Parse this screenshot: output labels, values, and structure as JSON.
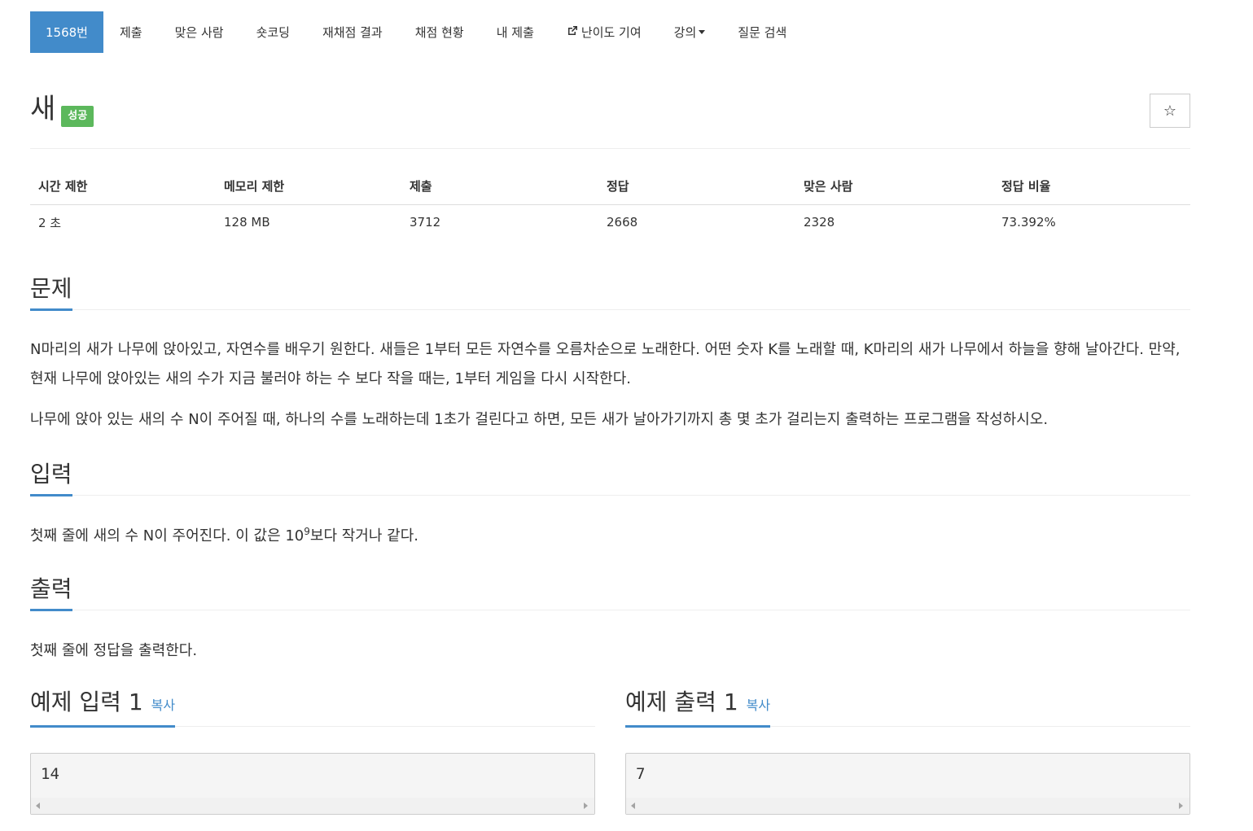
{
  "nav": {
    "items": [
      {
        "label": "1568번",
        "active": true
      },
      {
        "label": "제출"
      },
      {
        "label": "맞은 사람"
      },
      {
        "label": "숏코딩"
      },
      {
        "label": "재채점 결과"
      },
      {
        "label": "채점 현황"
      },
      {
        "label": "내 제출"
      },
      {
        "label": "난이도 기여",
        "icon": "external-link-icon"
      },
      {
        "label": "강의",
        "icon": "caret-down-icon"
      },
      {
        "label": "질문 검색"
      }
    ]
  },
  "problem": {
    "title": "새",
    "badge": "성공",
    "star_icon": "☆"
  },
  "info_table": {
    "headers": [
      "시간 제한",
      "메모리 제한",
      "제출",
      "정답",
      "맞은 사람",
      "정답 비율"
    ],
    "values": [
      "2 초",
      "128 MB",
      "3712",
      "2668",
      "2328",
      "73.392%"
    ]
  },
  "sections": {
    "description": {
      "heading": "문제",
      "p1": "N마리의 새가 나무에 앉아있고, 자연수를 배우기 원한다. 새들은 1부터 모든 자연수를 오름차순으로 노래한다. 어떤 숫자 K를 노래할 때, K마리의 새가 나무에서 하늘을 향해 날아간다. 만약, 현재 나무에 앉아있는 새의 수가 지금 불러야 하는 수 보다 작을 때는, 1부터 게임을 다시 시작한다.",
      "p2": "나무에 앉아 있는 새의 수 N이 주어질 때, 하나의 수를 노래하는데 1초가 걸린다고 하면, 모든 새가 날아가기까지 총 몇 초가 걸리는지 출력하는 프로그램을 작성하시오."
    },
    "input": {
      "heading": "입력",
      "text_before": "첫째 줄에 새의 수 N이 주어진다. 이 값은 10",
      "sup": "9",
      "text_after": "보다 작거나 같다."
    },
    "output": {
      "heading": "출력",
      "text": "첫째 줄에 정답을 출력한다."
    }
  },
  "samples": {
    "input": {
      "heading": "예제 입력 1",
      "copy": "복사",
      "value": "14"
    },
    "output": {
      "heading": "예제 출력 1",
      "copy": "복사",
      "value": "7"
    }
  },
  "colors": {
    "accent": "#428bca",
    "success": "#5cb85c"
  }
}
